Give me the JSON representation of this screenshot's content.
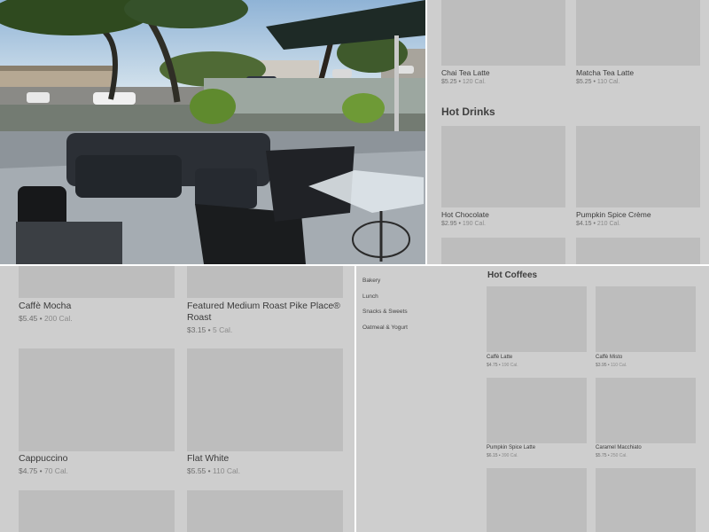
{
  "photo": {
    "alt": "Outdoor café patio with wicker sofas, black chairs and glass tables under an umbrella"
  },
  "top_right": {
    "items_top": [
      {
        "name": "Chai Tea Latte",
        "price": "$5.25",
        "cal": "120 Cal."
      },
      {
        "name": "Matcha Tea Latte",
        "price": "$5.25",
        "cal": "110 Cal."
      }
    ],
    "section_title": "Hot Drinks",
    "items_bottom": [
      {
        "name": "Hot Chocolate",
        "price": "$2.95",
        "cal": "190 Cal."
      },
      {
        "name": "Pumpkin Spice Crème",
        "price": "$4.15",
        "cal": "210 Cal."
      }
    ]
  },
  "bottom_left": {
    "items": [
      {
        "name": "Caffè Mocha",
        "price": "$5.45",
        "cal": "200 Cal."
      },
      {
        "name": "Featured Medium Roast Pike Place® Roast",
        "price": "$3.15",
        "cal": "5 Cal."
      },
      {
        "name": "Cappuccino",
        "price": "$4.75",
        "cal": "70 Cal."
      },
      {
        "name": "Flat White",
        "price": "$5.55",
        "cal": "110 Cal."
      }
    ]
  },
  "bottom_right": {
    "categories": [
      "Bakery",
      "Lunch",
      "Snacks & Sweets",
      "Oatmeal & Yogurt"
    ],
    "section_title": "Hot Coffees",
    "items": [
      {
        "name": "Caffè Latte",
        "price": "$4.75",
        "cal": "190 Cal."
      },
      {
        "name": "Caffè Misto",
        "price": "$3.95",
        "cal": "110 Cal."
      },
      {
        "name": "Pumpkin Spice Latte",
        "price": "$6.15",
        "cal": "390 Cal."
      },
      {
        "name": "Caramel Macchiato",
        "price": "$5.75",
        "cal": "250 Cal."
      }
    ]
  },
  "separator": " • "
}
